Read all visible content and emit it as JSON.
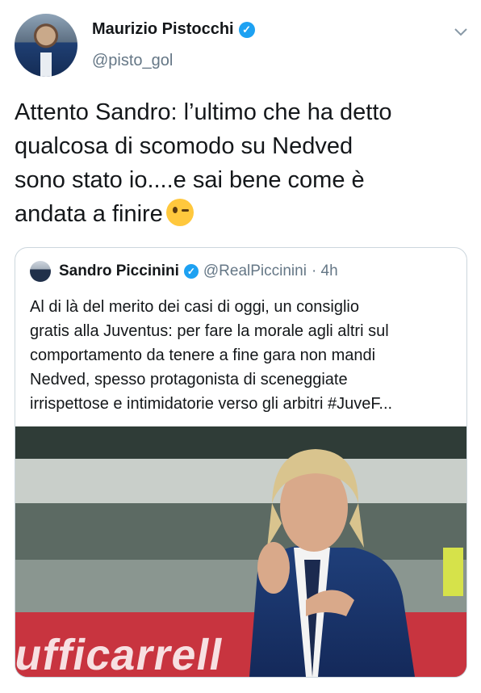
{
  "author": {
    "name": "Maurizio Pistocchi",
    "handle": "@pisto_gol",
    "verified_icon": "verified-badge-icon"
  },
  "tweet": {
    "lines": [
      "Attento Sandro: l’ultimo che ha detto",
      "qualcosa di scomodo su Nedved",
      "sono stato io....e sai bene come è",
      "andata a finire"
    ],
    "emoji": "winking-face-icon"
  },
  "quoted_tweet": {
    "name": "Sandro Piccinini",
    "handle": "@RealPiccinini",
    "time": "· 4h",
    "lines": [
      "Al di là del merito dei casi di oggi, un consiglio",
      "gratis alla Juventus: per fare la morale agli altri sul",
      "comportamento da tenere a fine gara non mandi",
      "Nedved, spesso protagonista di sceneggiate",
      "irrispettose e intimidatorie verso gli arbitri #JuveF..."
    ],
    "image_banner_text": "ufficarrell"
  },
  "colors": {
    "accent": "#1da1f2",
    "text": "#14171a",
    "secondary": "#657786",
    "border": "#ccd6dd"
  }
}
